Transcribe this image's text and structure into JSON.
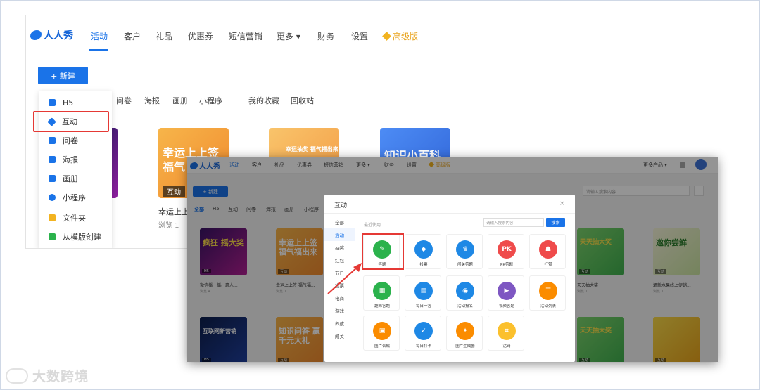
{
  "back": {
    "logo": "人人秀",
    "nav": [
      "活动",
      "客户",
      "礼品",
      "优惠券",
      "短信营销",
      "更多 ▾",
      "财务",
      "设置"
    ],
    "pro": "高级版",
    "new_button": "+ 新建",
    "menu": [
      "H5",
      "互动",
      "问卷",
      "海报",
      "画册",
      "小程序",
      "文件夹",
      "从模版创建"
    ],
    "tabs": [
      "问卷",
      "海报",
      "画册",
      "小程序",
      "我的收藏",
      "回收站"
    ],
    "card1_text": "幸运上上签 福气",
    "card2_text": "幸运抽奖 福气福出来",
    "card3_text": "知识小百科",
    "card_label": "互动",
    "card_caption": "幸运上上",
    "card_views": "浏览 1"
  },
  "front": {
    "logo": "人人秀",
    "nav": [
      "活动",
      "客户",
      "礼品",
      "优惠券",
      "短信营销",
      "更多 ▾",
      "财务",
      "设置"
    ],
    "pro": "高级版",
    "more_products": "更多产品 ▾",
    "new_button": "+ 新建",
    "search_placeholder": "请输入搜索内容",
    "tabs": [
      "全部",
      "H5",
      "互动",
      "问卷",
      "海报",
      "画册",
      "小程序"
    ],
    "cards": [
      {
        "text": "疯狂 摇大奖",
        "caption": "微信摇一摇、惠人...",
        "views": "浏览 4",
        "tag": "H5"
      },
      {
        "text": "幸运上上签 福气福出来",
        "caption": "幸运上上签 福气福...",
        "views": "浏览 1",
        "tag": "互动"
      },
      {
        "text": "互联网新营销",
        "caption": "",
        "views": "",
        "tag": "H5"
      },
      {
        "text": "知识问答 赢千元大礼",
        "caption": "",
        "views": "",
        "tag": "互动"
      },
      {
        "text": "天天抽大奖",
        "caption": "天天抽大奖",
        "views": "浏览 1",
        "tag": "互动"
      },
      {
        "text": "邀你尝鲜",
        "caption": "酒新水果线上促销...",
        "views": "浏览 1",
        "tag": "互动"
      },
      {
        "text": "天天抽大奖",
        "caption": "",
        "views": "",
        "tag": "互动"
      },
      {
        "text": "",
        "caption": "",
        "views": "",
        "tag": "互动"
      }
    ]
  },
  "modal": {
    "title": "互动",
    "close": "×",
    "sidebar": [
      "全部",
      "活动",
      "抽奖",
      "红包",
      "节日",
      "投票",
      "电商",
      "游戏",
      "养成",
      "闯关"
    ],
    "recent": "最近使用",
    "search_placeholder": "请输入搜索内容",
    "search_button": "搜索",
    "tiles": [
      {
        "label": "答题",
        "icon": "pencil-icon",
        "color": "#2bb24c",
        "glyph": "✎"
      },
      {
        "label": "投票",
        "icon": "vote-icon",
        "color": "#1e88e5",
        "glyph": "◆"
      },
      {
        "label": "闯关答题",
        "icon": "trophy-icon",
        "color": "#1e88e5",
        "glyph": "♛"
      },
      {
        "label": "PK答题",
        "icon": "pk-icon",
        "color": "#ef4b4b",
        "glyph": "PK"
      },
      {
        "label": "打赏",
        "icon": "reward-icon",
        "color": "#ef4b4b",
        "glyph": "☗"
      },
      {
        "label": "趣味答题",
        "icon": "picture-icon",
        "color": "#2bb24c",
        "glyph": "▦"
      },
      {
        "label": "每日一答",
        "icon": "calendar-icon",
        "color": "#1e88e5",
        "glyph": "▤"
      },
      {
        "label": "活动报名",
        "icon": "signup-icon",
        "color": "#1e88e5",
        "glyph": "◉"
      },
      {
        "label": "视频答题",
        "icon": "video-icon",
        "color": "#7e57c2",
        "glyph": "▶"
      },
      {
        "label": "活动列表",
        "icon": "list-icon",
        "color": "#fb8c00",
        "glyph": "☰"
      },
      {
        "label": "图片合成",
        "icon": "image-compose-icon",
        "color": "#fb8c00",
        "glyph": "▣"
      },
      {
        "label": "每日打卡",
        "icon": "checkin-icon",
        "color": "#1e88e5",
        "glyph": "✓"
      },
      {
        "label": "图片生成器",
        "icon": "magic-icon",
        "color": "#fb8c00",
        "glyph": "✦"
      },
      {
        "label": "活码",
        "icon": "qrcode-icon",
        "color": "#fbc02d",
        "glyph": "⌗"
      }
    ]
  },
  "watermark": "大数跨境"
}
